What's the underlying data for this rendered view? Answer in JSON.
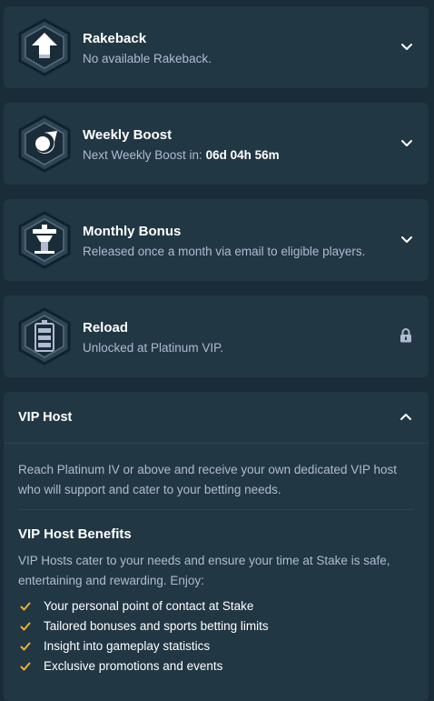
{
  "colors": {
    "page_bg": "#1a2c38",
    "card_bg": "#213743",
    "muted_text": "#b1bad3",
    "check_color": "#f2b02c"
  },
  "rewards": [
    {
      "title": "Rakeback",
      "subtitle": "No available Rakeback.",
      "icon": "rakeback-badge-icon",
      "action": "chevron-down-icon"
    },
    {
      "title": "Weekly Boost",
      "subtitle_prefix": "Next Weekly Boost in: ",
      "subtitle_value": "06d 04h 56m",
      "icon": "weekly-boost-badge-icon",
      "action": "chevron-down-icon"
    },
    {
      "title": "Monthly Bonus",
      "subtitle": "Released once a month via email to eligible players.",
      "icon": "monthly-bonus-badge-icon",
      "action": "chevron-down-icon"
    },
    {
      "title": "Reload",
      "subtitle": "Unlocked at Platinum VIP.",
      "icon": "reload-badge-icon",
      "action": "lock-icon"
    }
  ],
  "vip_host": {
    "title": "VIP Host",
    "description": "Reach Platinum IV or above and receive your own dedicated VIP host who will support and cater to your betting needs.",
    "benefits_title": "VIP Host Benefits",
    "benefits_description": "VIP Hosts cater to your needs and ensure your time at Stake is safe, entertaining and rewarding. Enjoy:",
    "benefits": [
      "Your personal point of contact at Stake",
      "Tailored bonuses and sports betting limits",
      "Insight into gameplay statistics",
      "Exclusive promotions and events"
    ]
  }
}
